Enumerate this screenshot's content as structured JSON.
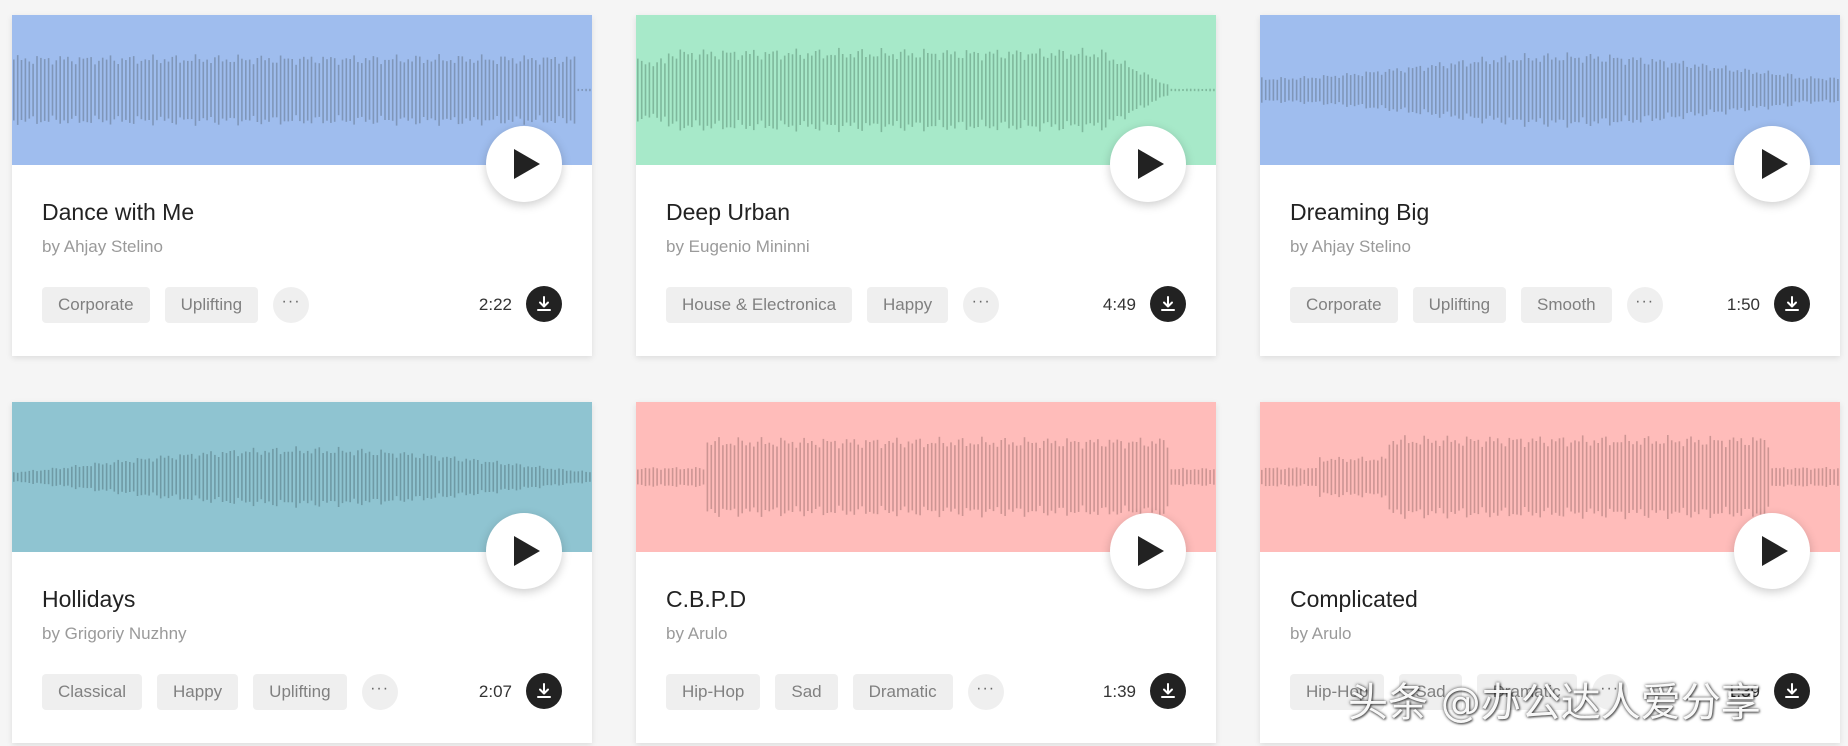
{
  "tracks": [
    {
      "title": "Dance with Me",
      "artist": "by Ahjay Stelino",
      "tags": [
        "Corporate",
        "Uplifting"
      ],
      "duration": "2:22",
      "wave_color": "#9fbdee",
      "bar_color": "#7f96b9"
    },
    {
      "title": "Deep Urban",
      "artist": "by Eugenio Mininni",
      "tags": [
        "House & Electronica",
        "Happy"
      ],
      "duration": "4:49",
      "wave_color": "#a7e9c9",
      "bar_color": "#7fb89c"
    },
    {
      "title": "Dreaming Big",
      "artist": "by Ahjay Stelino",
      "tags": [
        "Corporate",
        "Uplifting",
        "Smooth"
      ],
      "duration": "1:50",
      "wave_color": "#9fbdee",
      "bar_color": "#7f96b9"
    },
    {
      "title": "Hollidays",
      "artist": "by Grigoriy Nuzhny",
      "tags": [
        "Classical",
        "Happy",
        "Uplifting"
      ],
      "duration": "2:07",
      "wave_color": "#8fc4d1",
      "bar_color": "#6f9aa5"
    },
    {
      "title": "C.B.P.D",
      "artist": "by Arulo",
      "tags": [
        "Hip-Hop",
        "Sad",
        "Dramatic"
      ],
      "duration": "1:39",
      "wave_color": "#ffbcba",
      "bar_color": "#cc9593"
    },
    {
      "title": "Complicated",
      "artist": "by Arulo",
      "tags": [
        "Hip-Hop",
        "Sad",
        "Dramatic"
      ],
      "duration": "1:39",
      "wave_color": "#ffbcba",
      "bar_color": "#cc9593"
    }
  ],
  "more_label": "···",
  "icons": {
    "play": "play-icon",
    "download": "download-icon",
    "more": "more-icon"
  },
  "watermark": "头条 @办公达人爱分享"
}
